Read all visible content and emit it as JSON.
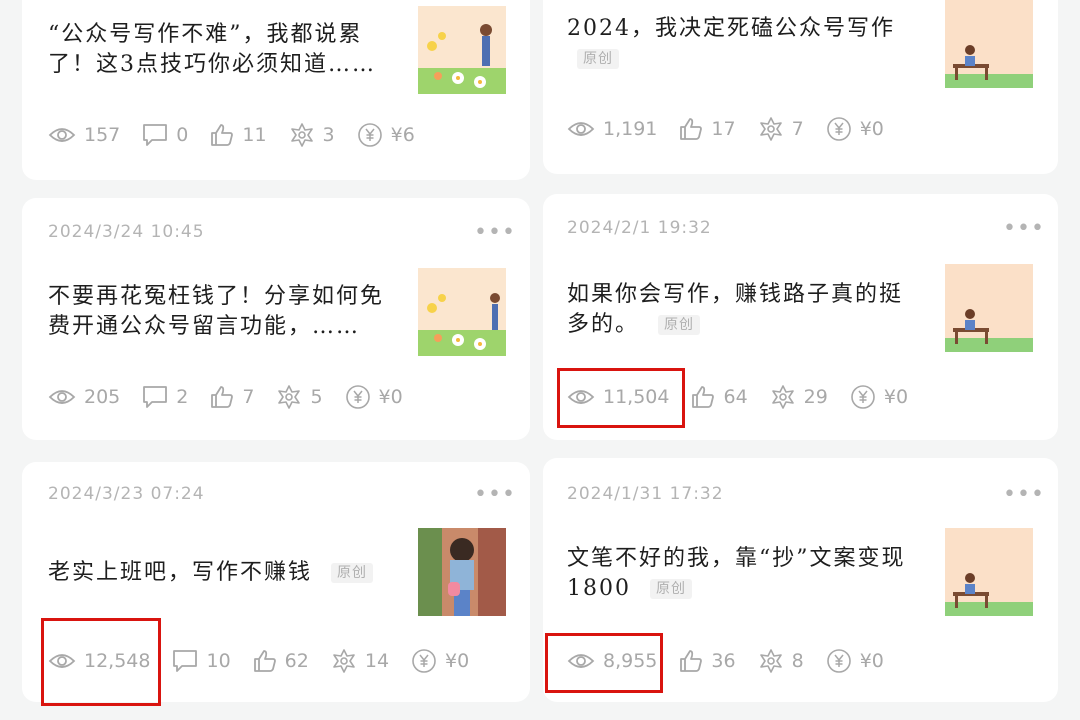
{
  "cards": [
    {
      "date": "",
      "title": "“公众号写作不难”，我都说累了！这3点技巧你必须知道……",
      "original": "",
      "views": "157",
      "comments": "0",
      "likes": "11",
      "shares": "3",
      "earnings": "¥6"
    },
    {
      "date": "",
      "title": "2024，我决定死磕公众号写作",
      "original": "原创",
      "views": "1,191",
      "comments": "",
      "likes": "17",
      "shares": "7",
      "earnings": "¥0"
    },
    {
      "date": "2024/3/24 10:45",
      "title": "不要再花冤枉钱了！分享如何免费开通公众号留言功能，……",
      "original": "",
      "views": "205",
      "comments": "2",
      "likes": "7",
      "shares": "5",
      "earnings": "¥0"
    },
    {
      "date": "2024/2/1 19:32",
      "title": "如果你会写作，赚钱路子真的挺多的。",
      "original": "原创",
      "views": "11,504",
      "comments": "",
      "likes": "64",
      "shares": "29",
      "earnings": "¥0"
    },
    {
      "date": "2024/3/23 07:24",
      "title": "老实上班吧，写作不赚钱",
      "original": "原创",
      "views": "12,548",
      "comments": "10",
      "likes": "62",
      "shares": "14",
      "earnings": "¥0"
    },
    {
      "date": "2024/1/31 17:32",
      "title": "文笔不好的我，靠“抄”文案变现1800",
      "original": "原创",
      "views": "8,955",
      "comments": "",
      "likes": "36",
      "shares": "8",
      "earnings": "¥0"
    }
  ],
  "more_icon": "more-dots-icon",
  "colors": {
    "highlight": "#d9140f",
    "background": "#f4f5f5",
    "card": "#ffffff"
  }
}
